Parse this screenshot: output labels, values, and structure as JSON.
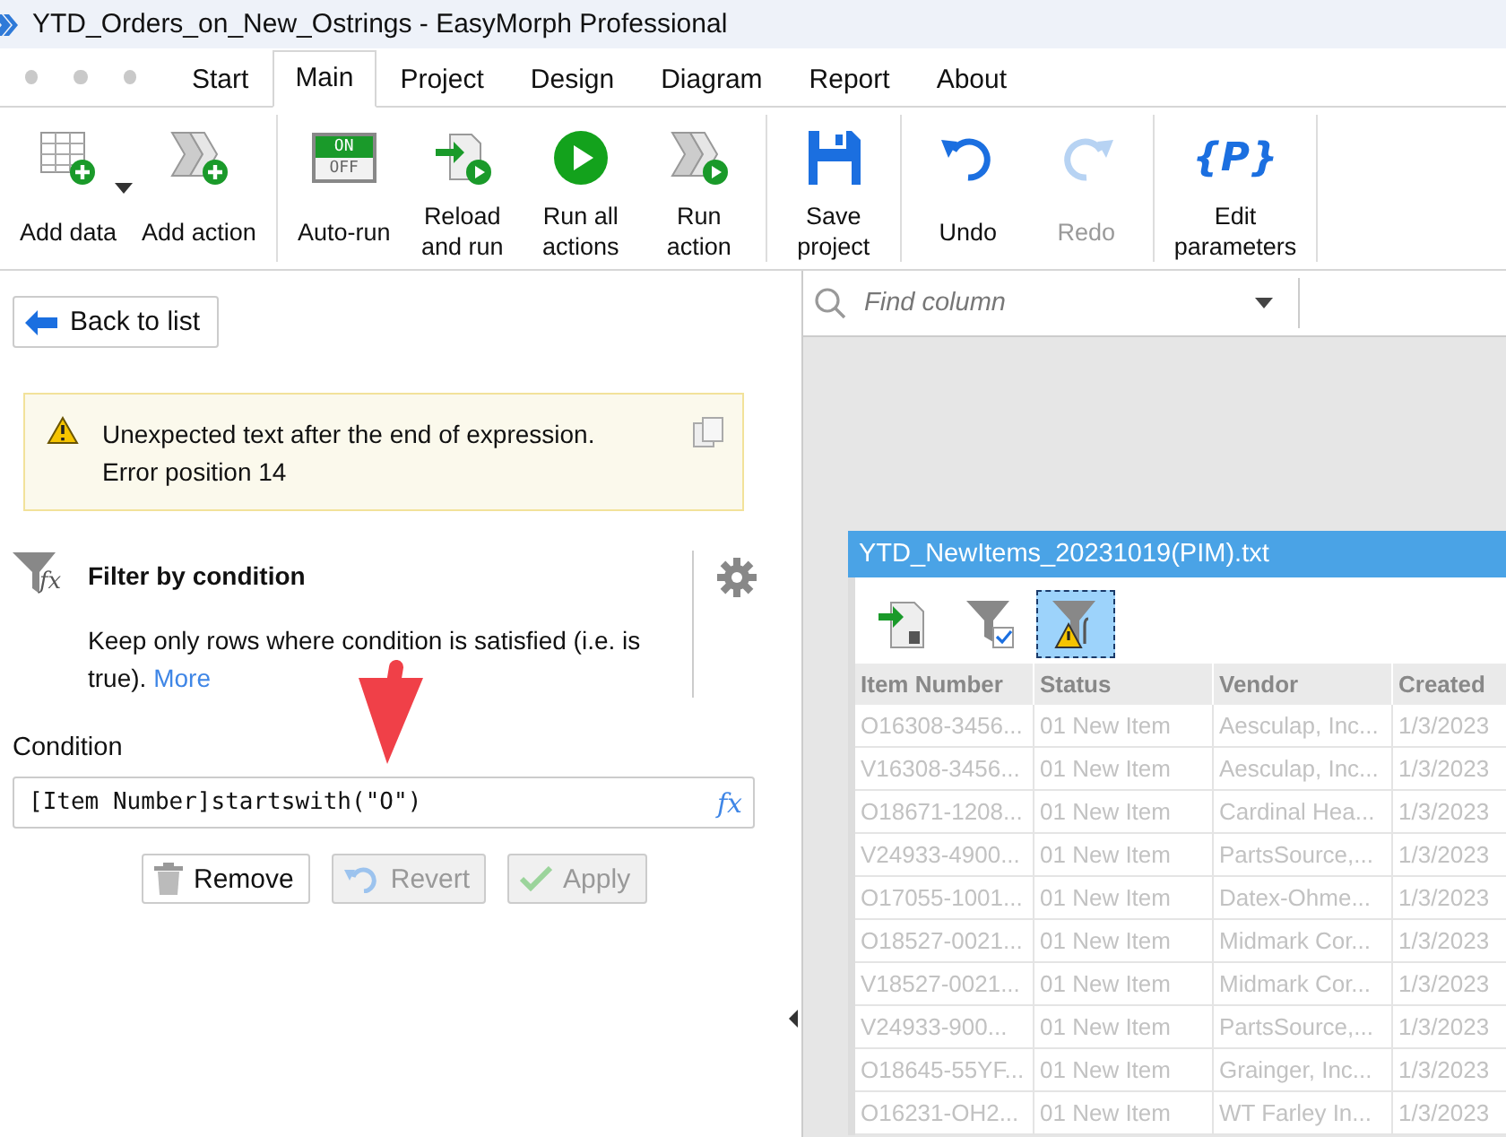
{
  "window": {
    "title": "YTD_Orders_on_New_Ostrings - EasyMorph Professional"
  },
  "tabs": [
    {
      "label": "Start",
      "selected": false
    },
    {
      "label": "Main",
      "selected": true
    },
    {
      "label": "Project",
      "selected": false
    },
    {
      "label": "Design",
      "selected": false
    },
    {
      "label": "Diagram",
      "selected": false
    },
    {
      "label": "Report",
      "selected": false
    },
    {
      "label": "About",
      "selected": false
    }
  ],
  "ribbon": {
    "groups": [
      [
        {
          "kind": "add-data",
          "label": "Add data",
          "disabled": false,
          "dropdown": true
        },
        {
          "kind": "add-action",
          "label": "Add action",
          "disabled": false,
          "dropdown": false
        }
      ],
      [
        {
          "kind": "auto-run",
          "label": "Auto-run",
          "disabled": false,
          "dropdown": false,
          "glyphs": [
            "ON",
            "OFF"
          ]
        },
        {
          "kind": "reload",
          "label": "Reload\nand run",
          "disabled": false,
          "dropdown": false
        },
        {
          "kind": "run-all",
          "label": "Run all\nactions",
          "disabled": false,
          "dropdown": false
        },
        {
          "kind": "run-action",
          "label": "Run\naction",
          "disabled": false,
          "dropdown": false
        }
      ],
      [
        {
          "kind": "save",
          "label": "Save\nproject",
          "disabled": false,
          "dropdown": false
        }
      ],
      [
        {
          "kind": "undo",
          "label": "Undo",
          "disabled": false,
          "dropdown": false
        },
        {
          "kind": "redo",
          "label": "Redo",
          "disabled": true,
          "dropdown": false
        }
      ],
      [
        {
          "kind": "params",
          "label": "Edit\nparameters",
          "disabled": false,
          "dropdown": false,
          "glyphs": [
            "{P}"
          ]
        }
      ]
    ]
  },
  "left_panel": {
    "back_button": "Back to list",
    "error": {
      "lines": [
        "Unexpected text after the end of expression.",
        "Error position 14"
      ]
    },
    "action": {
      "icon_glyph": "fx",
      "title": "Filter by condition",
      "description": "Keep only rows where condition is satisfied (i.e. is true).",
      "link": "More"
    },
    "condition": {
      "label": "Condition",
      "value": "[Item Number]startswith(\"O\")",
      "formula_glyph": "fx"
    },
    "buttons": [
      {
        "kind": "remove",
        "label": "Remove",
        "disabled": false
      },
      {
        "kind": "revert",
        "label": "Revert",
        "disabled": true
      },
      {
        "kind": "apply",
        "label": "Apply",
        "disabled": true
      }
    ]
  },
  "right_panel": {
    "find_column": {
      "placeholder": "Find column"
    },
    "data_window": {
      "title": "YTD_NewItems_20231019(PIM).txt",
      "dimmed": true,
      "tools": [
        {
          "kind": "import",
          "selected": false
        },
        {
          "kind": "filter",
          "selected": false
        },
        {
          "kind": "filter-expression",
          "selected": true
        }
      ],
      "columns": [
        "Item Number",
        "Status",
        "Vendor",
        "Created"
      ],
      "rows": [
        [
          "O16308-3456...",
          "01 New Item",
          "Aesculap, Inc...",
          "1/3/2023"
        ],
        [
          "V16308-3456...",
          "01 New Item",
          "Aesculap, Inc...",
          "1/3/2023"
        ],
        [
          "O18671-1208...",
          "01 New Item",
          "Cardinal Hea...",
          "1/3/2023"
        ],
        [
          "V24933-4900...",
          "01 New Item",
          "PartsSource,...",
          "1/3/2023"
        ],
        [
          "O17055-1001...",
          "01 New Item",
          "Datex-Ohme...",
          "1/3/2023"
        ],
        [
          "O18527-0021...",
          "01 New Item",
          "Midmark Cor...",
          "1/3/2023"
        ],
        [
          "V18527-0021...",
          "01 New Item",
          "Midmark Cor...",
          "1/3/2023"
        ],
        [
          "V24933-900...",
          "01 New Item",
          "PartsSource,...",
          "1/3/2023"
        ],
        [
          "O18645-55YF...",
          "01 New Item",
          "Grainger, Inc...",
          "1/3/2023"
        ],
        [
          "O16231-OH2...",
          "01 New Item",
          "WT Farley In...",
          "1/3/2023"
        ]
      ]
    }
  }
}
